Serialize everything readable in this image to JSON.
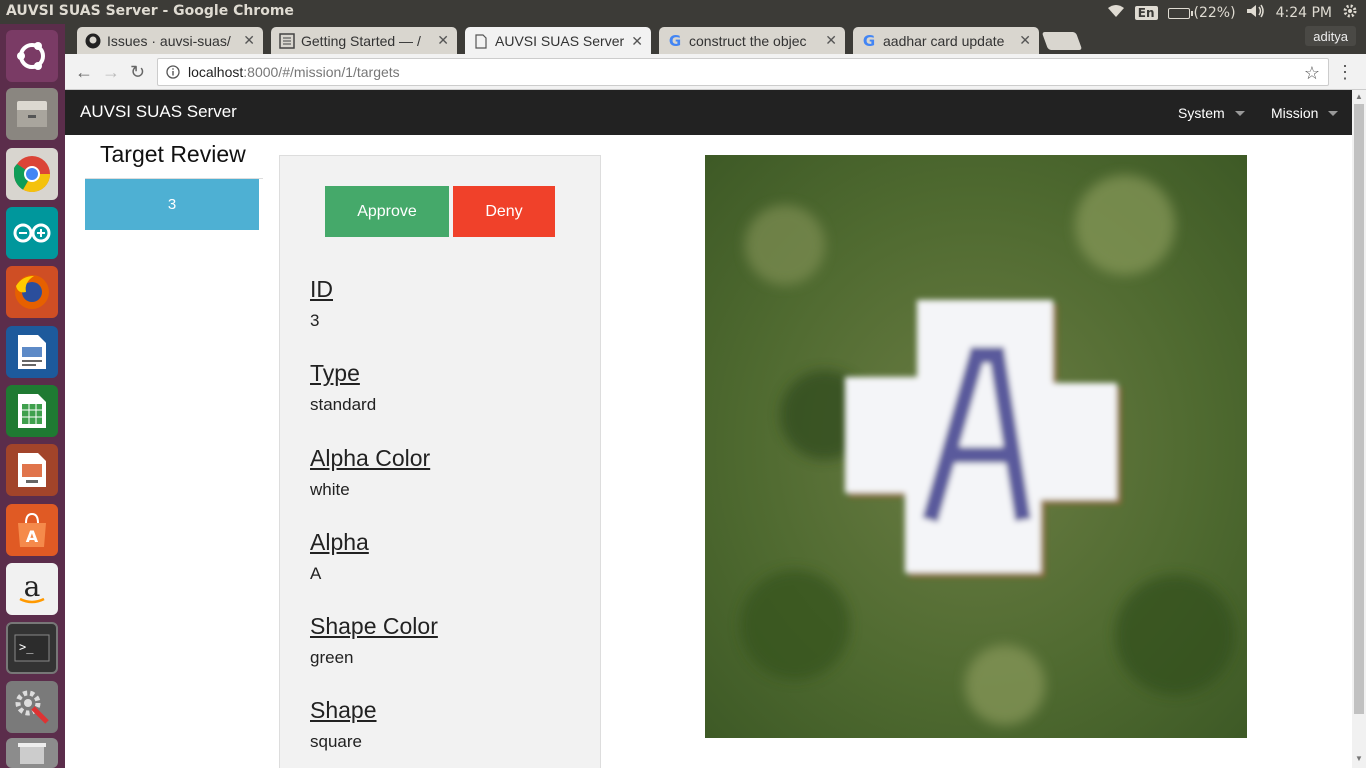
{
  "os": {
    "window_title": "AUVSI SUAS Server - Google Chrome",
    "keyboard": "En",
    "battery": "(22%)",
    "clock": "4:24 PM",
    "icons": [
      "wifi-icon",
      "battery-icon",
      "volume-icon",
      "settings-gear-icon"
    ]
  },
  "launcher": {
    "items": [
      "ubuntu-dash-icon",
      "files-icon",
      "chrome-icon",
      "arduino-icon",
      "firefox-icon",
      "writer-icon",
      "calc-icon",
      "impress-icon",
      "software-center-icon",
      "amazon-icon",
      "terminal-icon",
      "system-settings-icon",
      "trash-icon"
    ]
  },
  "browser": {
    "tabs": [
      {
        "label": "Issues · auvsi-suas/"
      },
      {
        "label": "Getting Started — /"
      },
      {
        "label": "AUVSI SUAS Server"
      },
      {
        "label": "construct the objec"
      },
      {
        "label": "aadhar card update"
      }
    ],
    "user": "aditya",
    "url_host": "localhost",
    "url_path": ":8000/#/mission/1/targets"
  },
  "navbar": {
    "brand": "AUVSI SUAS Server",
    "menus": [
      "System",
      "Mission"
    ]
  },
  "sidebar": {
    "title": "Target Review",
    "targets": [
      "3"
    ]
  },
  "actions": {
    "approve": "Approve",
    "deny": "Deny"
  },
  "target": {
    "fields": [
      {
        "label": "ID",
        "value": "3"
      },
      {
        "label": "Type",
        "value": "standard"
      },
      {
        "label": "Alpha Color",
        "value": "white"
      },
      {
        "label": "Alpha",
        "value": "A"
      },
      {
        "label": "Shape Color",
        "value": "green"
      },
      {
        "label": "Shape",
        "value": "square"
      }
    ],
    "image": {
      "letter": "A",
      "background": "#556b36",
      "shape_fill": "#f4f5f8",
      "letter_color": "#5a5a9c"
    }
  }
}
